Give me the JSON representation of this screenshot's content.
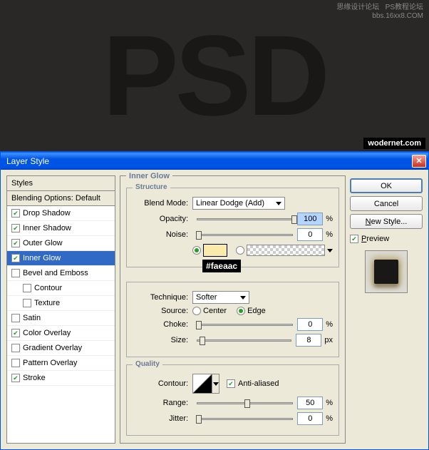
{
  "preview_text": "PSD",
  "watermark_tr_l1": "思缘设计论坛",
  "watermark_tr_l2": "bbs.16xx8.COM",
  "watermark_tr_r1": "PS教程论坛",
  "watermark_br": "wodernet.com",
  "dialog": {
    "title": "Layer Style"
  },
  "styles_panel": {
    "header": "Styles",
    "blending": "Blending Options: Default",
    "items": [
      {
        "label": "Drop Shadow",
        "checked": true
      },
      {
        "label": "Inner Shadow",
        "checked": true
      },
      {
        "label": "Outer Glow",
        "checked": true
      },
      {
        "label": "Inner Glow",
        "checked": true,
        "selected": true
      },
      {
        "label": "Bevel and Emboss",
        "checked": false
      },
      {
        "label": "Contour",
        "checked": false,
        "indent": true
      },
      {
        "label": "Texture",
        "checked": false,
        "indent": true
      },
      {
        "label": "Satin",
        "checked": false
      },
      {
        "label": "Color Overlay",
        "checked": true
      },
      {
        "label": "Gradient Overlay",
        "checked": false
      },
      {
        "label": "Pattern Overlay",
        "checked": false
      },
      {
        "label": "Stroke",
        "checked": true
      }
    ]
  },
  "main": {
    "title": "Inner Glow",
    "structure": {
      "title": "Structure",
      "blend_mode_label": "Blend Mode:",
      "blend_mode_value": "Linear Dodge (Add)",
      "opacity_label": "Opacity:",
      "opacity_value": "100",
      "opacity_unit": "%",
      "noise_label": "Noise:",
      "noise_value": "0",
      "noise_unit": "%",
      "color_hex": "#faeaac"
    },
    "elements": {
      "technique_label": "Technique:",
      "technique_value": "Softer",
      "source_label": "Source:",
      "source_center": "Center",
      "source_edge": "Edge",
      "choke_label": "Choke:",
      "choke_value": "0",
      "choke_unit": "%",
      "size_label": "Size:",
      "size_value": "8",
      "size_unit": "px"
    },
    "quality": {
      "title": "Quality",
      "contour_label": "Contour:",
      "antialiased_label": "Anti-aliased",
      "range_label": "Range:",
      "range_value": "50",
      "range_unit": "%",
      "jitter_label": "Jitter:",
      "jitter_value": "0",
      "jitter_unit": "%"
    }
  },
  "buttons": {
    "ok": "OK",
    "cancel": "Cancel",
    "new_style": "New Style...",
    "preview": "Preview"
  }
}
